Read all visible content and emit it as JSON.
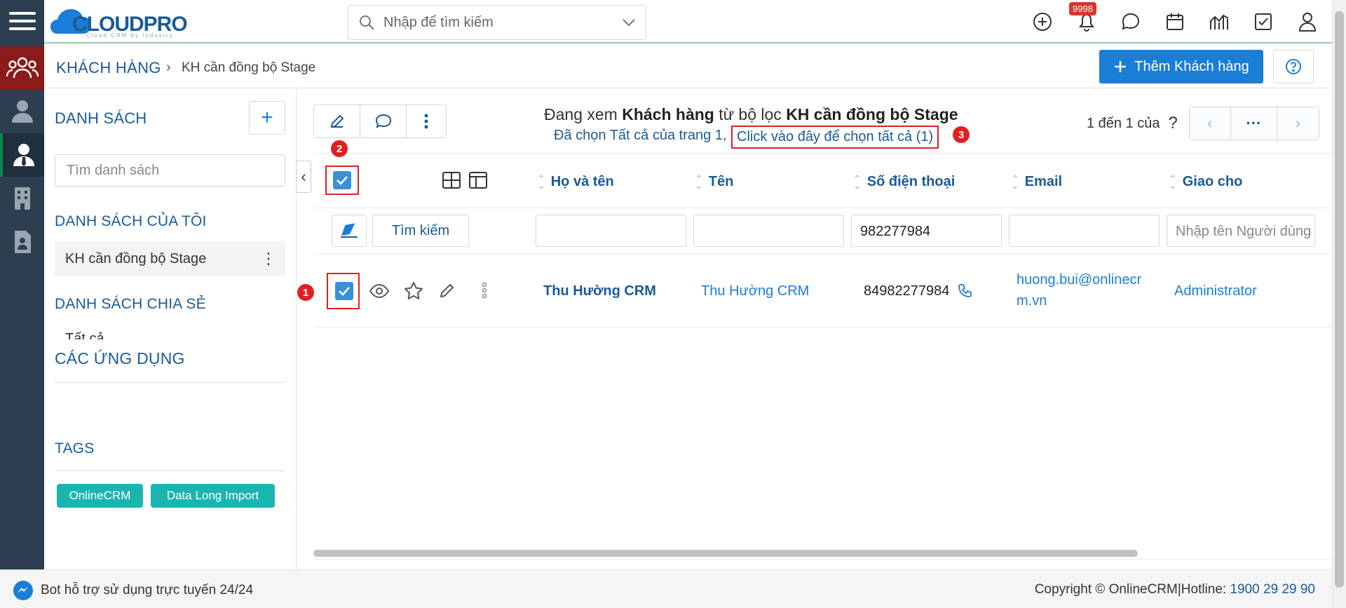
{
  "app": {
    "logo_text": "CLOUDPRO",
    "logo_tagline": "Cloud CRM by Industry"
  },
  "search": {
    "placeholder": "Nhập để tìm kiếm"
  },
  "header": {
    "notification_count": "9998"
  },
  "breadcrumb": {
    "module": "KHÁCH HÀNG",
    "current": "KH cần đồng bộ Stage"
  },
  "actions": {
    "add_label": "Thêm Khách hàng"
  },
  "sidebar": {
    "list_title": "DANH SÁCH",
    "list_search_placeholder": "Tìm danh sách",
    "my_lists_title": "DANH SÁCH CỦA TÔI",
    "my_lists": [
      {
        "label": "KH cần đồng bộ Stage"
      }
    ],
    "shared_title": "DANH SÁCH CHIA SẺ",
    "shared_cut": "Tất cả",
    "apps_title": "CÁC ỨNG DỤNG",
    "tags_title": "TAGS",
    "tags": [
      {
        "label": "OnlineCRM"
      },
      {
        "label": "Data Long Import"
      }
    ]
  },
  "view": {
    "prefix": "Đang xem",
    "module": "Khách hàng",
    "middle": "từ bộ lọc",
    "filter": "KH cần đồng bộ Stage",
    "selected_text": "Đã chọn Tất cả của trang 1,",
    "select_all_link": "Click vào đây để chọn tất cả (1)",
    "markers": {
      "m1": "1",
      "m2": "2",
      "m3": "3"
    }
  },
  "pager": {
    "text": "1 đến 1 của",
    "unknown": "?",
    "more": "···"
  },
  "table": {
    "columns": [
      "Họ và tên",
      "Tên",
      "Số điện thoại",
      "Email",
      "Giao cho"
    ],
    "filter": {
      "search_label": "Tìm kiếm",
      "phone_value": "982277984",
      "assignee_placeholder": "Nhập tên Người dùng"
    },
    "rows": [
      {
        "full_name": "Thu Hường CRM",
        "name": "Thu Hường CRM",
        "phone": "84982277984",
        "email_1": "huong.bui@onlinecr",
        "email_2": "m.vn",
        "assignee": "Administrator"
      }
    ]
  },
  "footer": {
    "bot": "Bot hỗ trợ sử dụng trực tuyến 24/24",
    "copyright": "Copyright © OnlineCRM|Hotline:",
    "hotline": "1900 29 29 90"
  },
  "colors": {
    "accent": "#1a7ed6",
    "link": "#1a5a9a",
    "tag": "#1bb5b0",
    "marker": "#e02020"
  }
}
